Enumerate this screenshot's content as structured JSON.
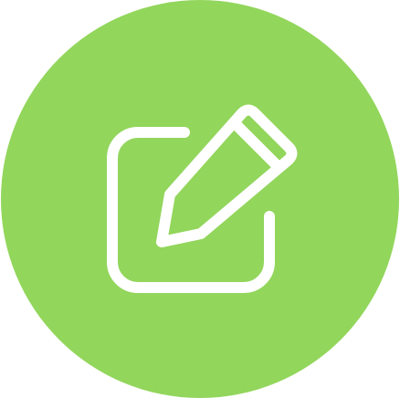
{
  "edit_button": {
    "icon": "edit-icon",
    "background_color": "#92d65c",
    "icon_color": "#ffffff"
  }
}
